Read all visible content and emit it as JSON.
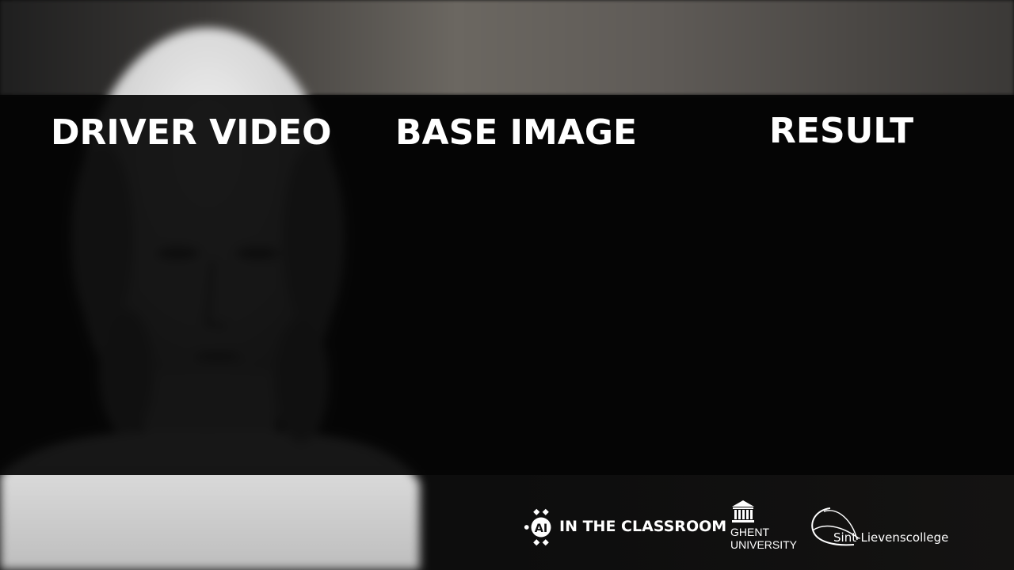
{
  "headings": {
    "driver_video": "DRIVER VIDEO",
    "base_image": "BASE IMAGE",
    "result": "RESULT"
  },
  "logos": {
    "ai_classroom": "IN THE CLASSROOM",
    "ai_mark": "AI",
    "ghent_line1": "GHENT",
    "ghent_line2": "UNIVERSITY",
    "sint_lievens": "Sint-Lievenscollege"
  },
  "colors": {
    "text": "#ffffff",
    "band": "#050505"
  }
}
